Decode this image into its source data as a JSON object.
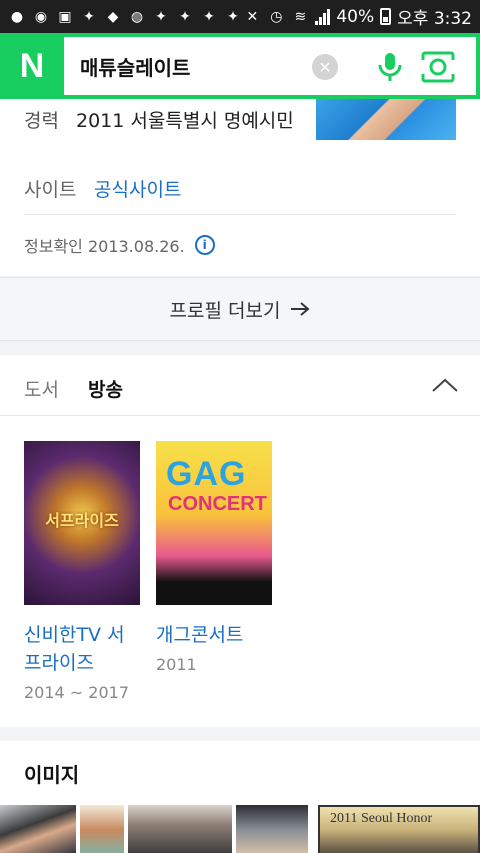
{
  "status_bar": {
    "battery": "40%",
    "clock": "오후 3:32"
  },
  "search": {
    "logo": "N",
    "query": "매튜슬레이트"
  },
  "profile": {
    "career_label": "경력",
    "career_value": "2011 서울특별시 명예시민",
    "site_label": "사이트",
    "site_link": "공식사이트",
    "info_date": "정보확인 2013.08.26.",
    "more_label": "프로필 더보기"
  },
  "works": {
    "tabs": [
      {
        "label": "도서"
      },
      {
        "label": "방송"
      }
    ],
    "items": [
      {
        "title": "신비한TV 서프라이즈",
        "years": "2014 ~ 2017"
      },
      {
        "title": "개그콘서트",
        "years": "2011"
      }
    ]
  },
  "images": {
    "title": "이미지"
  },
  "colors": {
    "brand": "#19ce60",
    "link": "#1a6fc4"
  },
  "icons": [
    "search-clear-icon",
    "microphone-icon",
    "lens-icon",
    "info-icon",
    "arrow-right-icon",
    "chevron-up-icon"
  ]
}
